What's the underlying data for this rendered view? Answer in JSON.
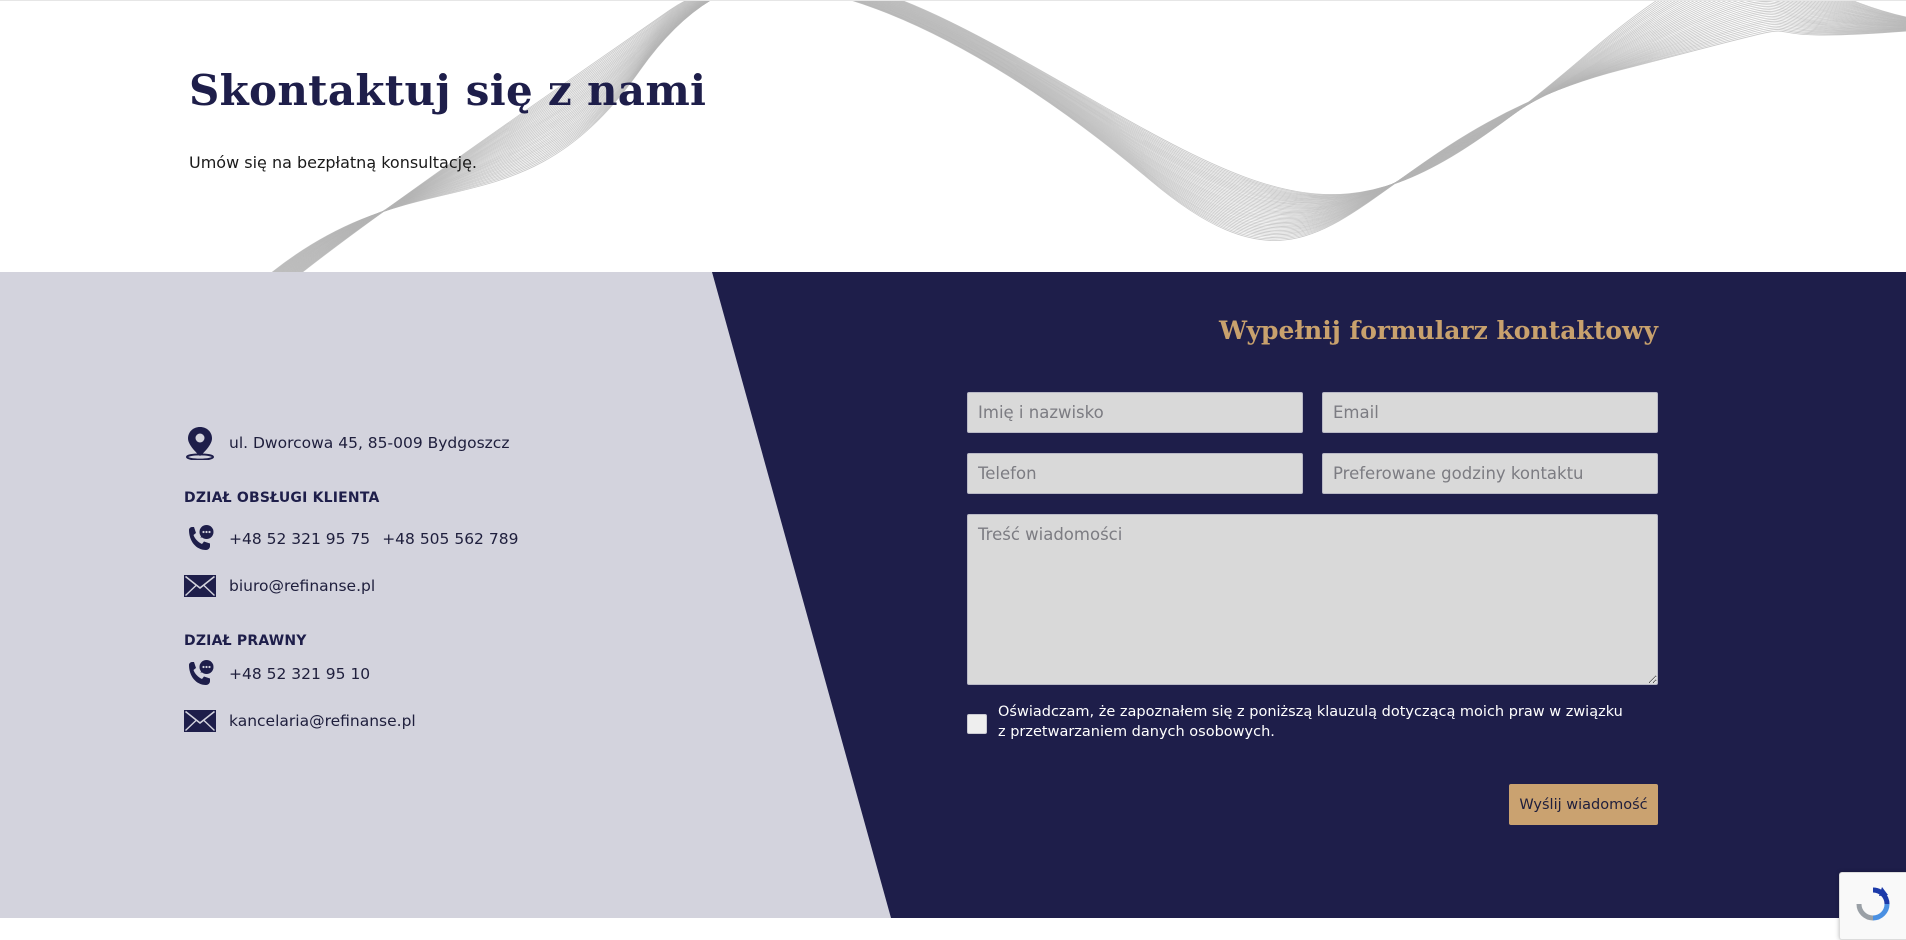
{
  "hero": {
    "title": "Skontaktuj się z nami",
    "subtitle": "Umów się na bezpłatną konsultację."
  },
  "contact_info": {
    "address": "ul. Dworcowa 45, 85-009 Bydgoszcz",
    "customer_service": {
      "heading": "DZIAŁ OBSŁUGI KLIENTA",
      "phone_1": "+48 52 321 95 75",
      "phone_2": "+48 505 562 789",
      "email": "biuro@refinanse.pl"
    },
    "legal": {
      "heading": "DZIAŁ PRAWNY",
      "phone": "+48 52 321 95 10",
      "email": "kancelaria@refinanse.pl"
    }
  },
  "form": {
    "title": "Wypełnij formularz kontaktowy",
    "name_placeholder": "Imię i nazwisko",
    "email_placeholder": "Email",
    "phone_placeholder": "Telefon",
    "hours_placeholder": "Preferowane godziny kontaktu",
    "message_placeholder": "Treść wiadomości",
    "consent_label": "Oświadczam, że zapoznałem się z poniższą klauzulą dotyczącą moich praw w związku z przetwarzaniem danych osobowych.",
    "consent_checked": false,
    "submit_label": "Wyślij wiadomość"
  },
  "icons": {
    "address": "map-pin-icon",
    "phone": "phone-chat-icon",
    "email": "envelope-icon",
    "recaptcha": "recaptcha-icon"
  },
  "colors": {
    "navy": "#1e1e4a",
    "gold": "#c8a16d",
    "panel_grey": "#d3d3dd",
    "field_grey": "#d9d9d9"
  }
}
